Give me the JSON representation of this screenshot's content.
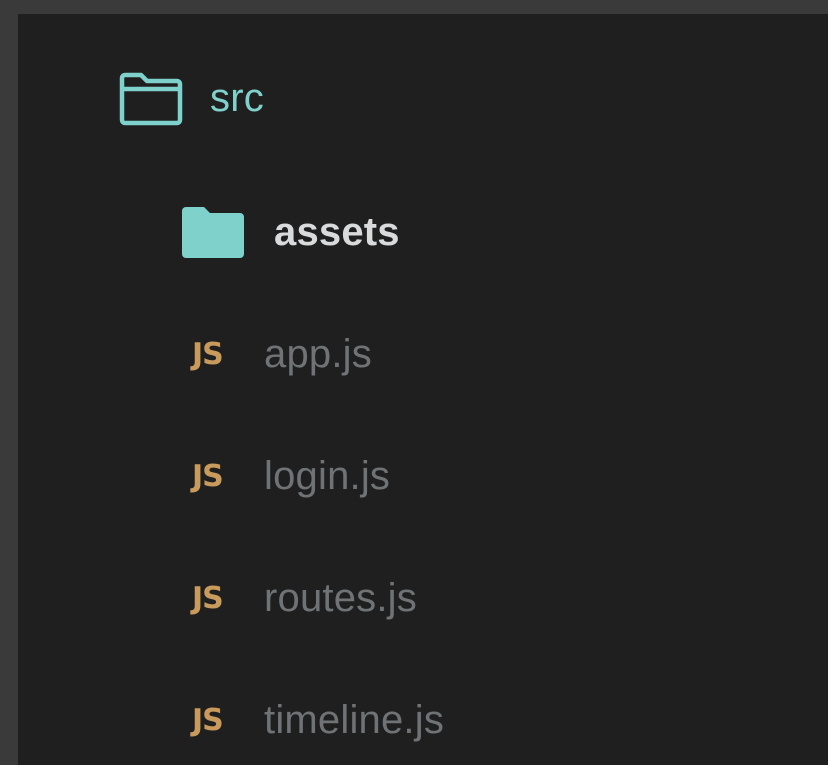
{
  "theme": {
    "accent": "#7fd1cb",
    "file_icon_color": "#c89a5c",
    "file_text_color": "#6f7376",
    "folder_text_color": "#d8dadc",
    "background": "#1f1f1f"
  },
  "tree": {
    "root": {
      "label": "src",
      "icon": "folder-outline-icon"
    },
    "folder": {
      "label": "assets",
      "icon": "folder-filled-icon"
    },
    "files": [
      {
        "badge": "JS",
        "label": "app.js"
      },
      {
        "badge": "JS",
        "label": "login.js"
      },
      {
        "badge": "JS",
        "label": "routes.js"
      },
      {
        "badge": "JS",
        "label": "timeline.js"
      }
    ]
  }
}
